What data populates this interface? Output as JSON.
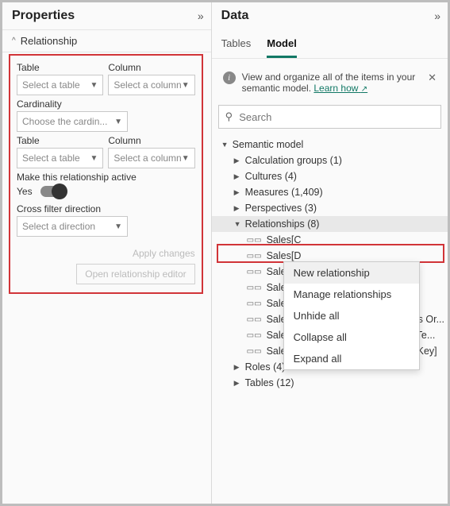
{
  "properties": {
    "title": "Properties",
    "section": "Relationship",
    "table_label": "Table",
    "column_label": "Column",
    "select_table_ph": "Select a table",
    "select_column_ph": "Select a column",
    "cardinality_label": "Cardinality",
    "cardinality_ph": "Choose the cardin...",
    "active_label": "Make this relationship active",
    "active_value": "Yes",
    "crossfilter_label": "Cross filter direction",
    "crossfilter_ph": "Select a direction",
    "apply": "Apply changes",
    "open_editor": "Open relationship editor"
  },
  "data": {
    "title": "Data",
    "tabs": {
      "tables": "Tables",
      "model": "Model"
    },
    "info_text": "View and organize all of the items in your semantic model. ",
    "learn_how": "Learn how",
    "search_ph": "Search",
    "tree": {
      "root": "Semantic model",
      "calc_groups": "Calculation groups (1)",
      "cultures": "Cultures (4)",
      "measures": "Measures (1,409)",
      "perspectives": "Perspectives (3)",
      "relationships": "Relationships (8)",
      "rel_items": [
        "Sales[C",
        "Sales[D",
        "Sales[C",
        "Sales[P",
        "Sales[R",
        "Sales[SalesOrderLineKey] — Sales Or...",
        "Sales[SalesTerritoryKey] <- Sales Te...",
        "Sales[ShipDateKey] <-- Date[DateKey]"
      ],
      "roles": "Roles (4)",
      "tables": "Tables (12)"
    },
    "context_menu": [
      "New relationship",
      "Manage relationships",
      "Unhide all",
      "Collapse all",
      "Expand all"
    ]
  }
}
